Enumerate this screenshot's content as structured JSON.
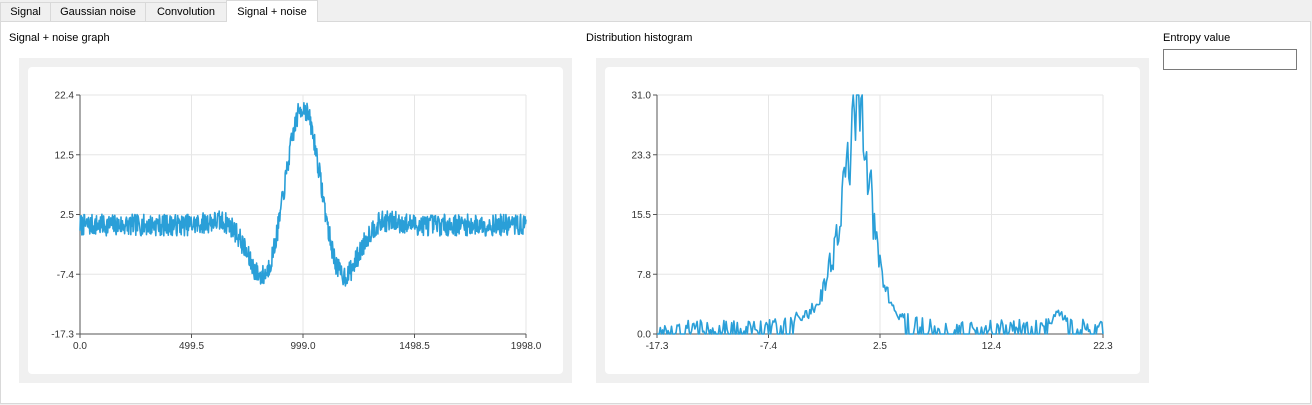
{
  "tabs": [
    {
      "label": "Signal",
      "active": false
    },
    {
      "label": "Gaussian noise",
      "active": false
    },
    {
      "label": "Convolution",
      "active": false
    },
    {
      "label": "Signal + noise",
      "active": true
    }
  ],
  "signal_section": {
    "label": "Signal + noise graph"
  },
  "histogram_section": {
    "label": "Distribution histogram"
  },
  "entropy": {
    "label": "Entropy value",
    "value": ""
  },
  "colors": {
    "series": "#2a9fd8",
    "grid": "#e6e6e6",
    "axis": "#555555"
  },
  "chart_data": [
    {
      "type": "line",
      "name": "signal-noise-graph",
      "xlim": [
        0.0,
        1998.0
      ],
      "ylim": [
        -17.3,
        22.4
      ],
      "x_ticks": [
        "0.0",
        "499.5",
        "999.0",
        "1498.5",
        "1998.0"
      ],
      "y_ticks": [
        "22.4",
        "12.5",
        "2.5",
        "-7.4",
        "-17.3"
      ],
      "grid": true,
      "waveform": {
        "description_free": true,
        "baseline": 0.8,
        "noise_amplitude": 1.8,
        "envelope_center": 999.0,
        "envelope_width": 220.0,
        "peak": 19.5,
        "period": 440.0,
        "num_points": 1000
      }
    },
    {
      "type": "line",
      "name": "distribution-histogram",
      "xlim": [
        -17.3,
        22.3
      ],
      "ylim": [
        0.0,
        31.0
      ],
      "x_ticks": [
        "-17.3",
        "-7.4",
        "2.5",
        "12.4",
        "22.3"
      ],
      "y_ticks": [
        "31.0",
        "23.3",
        "15.5",
        "7.8",
        "0.0"
      ],
      "grid": true,
      "anchor_points": [
        [
          -17.3,
          0.0
        ],
        [
          -15.0,
          1.0
        ],
        [
          -12.0,
          1.0
        ],
        [
          -9.0,
          1.0
        ],
        [
          -6.0,
          1.5
        ],
        [
          -4.0,
          2.5
        ],
        [
          -3.0,
          4.0
        ],
        [
          -2.3,
          7.0
        ],
        [
          -1.6,
          11.0
        ],
        [
          -1.0,
          15.0
        ],
        [
          -0.4,
          22.0
        ],
        [
          0.0,
          26.0
        ],
        [
          0.4,
          29.0
        ],
        [
          0.8,
          31.0
        ],
        [
          1.2,
          27.0
        ],
        [
          1.6,
          20.0
        ],
        [
          2.0,
          13.0
        ],
        [
          2.5,
          9.0
        ],
        [
          3.2,
          5.0
        ],
        [
          4.0,
          2.5
        ],
        [
          5.5,
          1.5
        ],
        [
          8.0,
          1.0
        ],
        [
          12.0,
          1.0
        ],
        [
          16.0,
          1.2
        ],
        [
          18.5,
          2.5
        ],
        [
          19.5,
          1.5
        ],
        [
          21.0,
          1.0
        ],
        [
          22.3,
          1.0
        ]
      ],
      "num_points": 400
    }
  ]
}
